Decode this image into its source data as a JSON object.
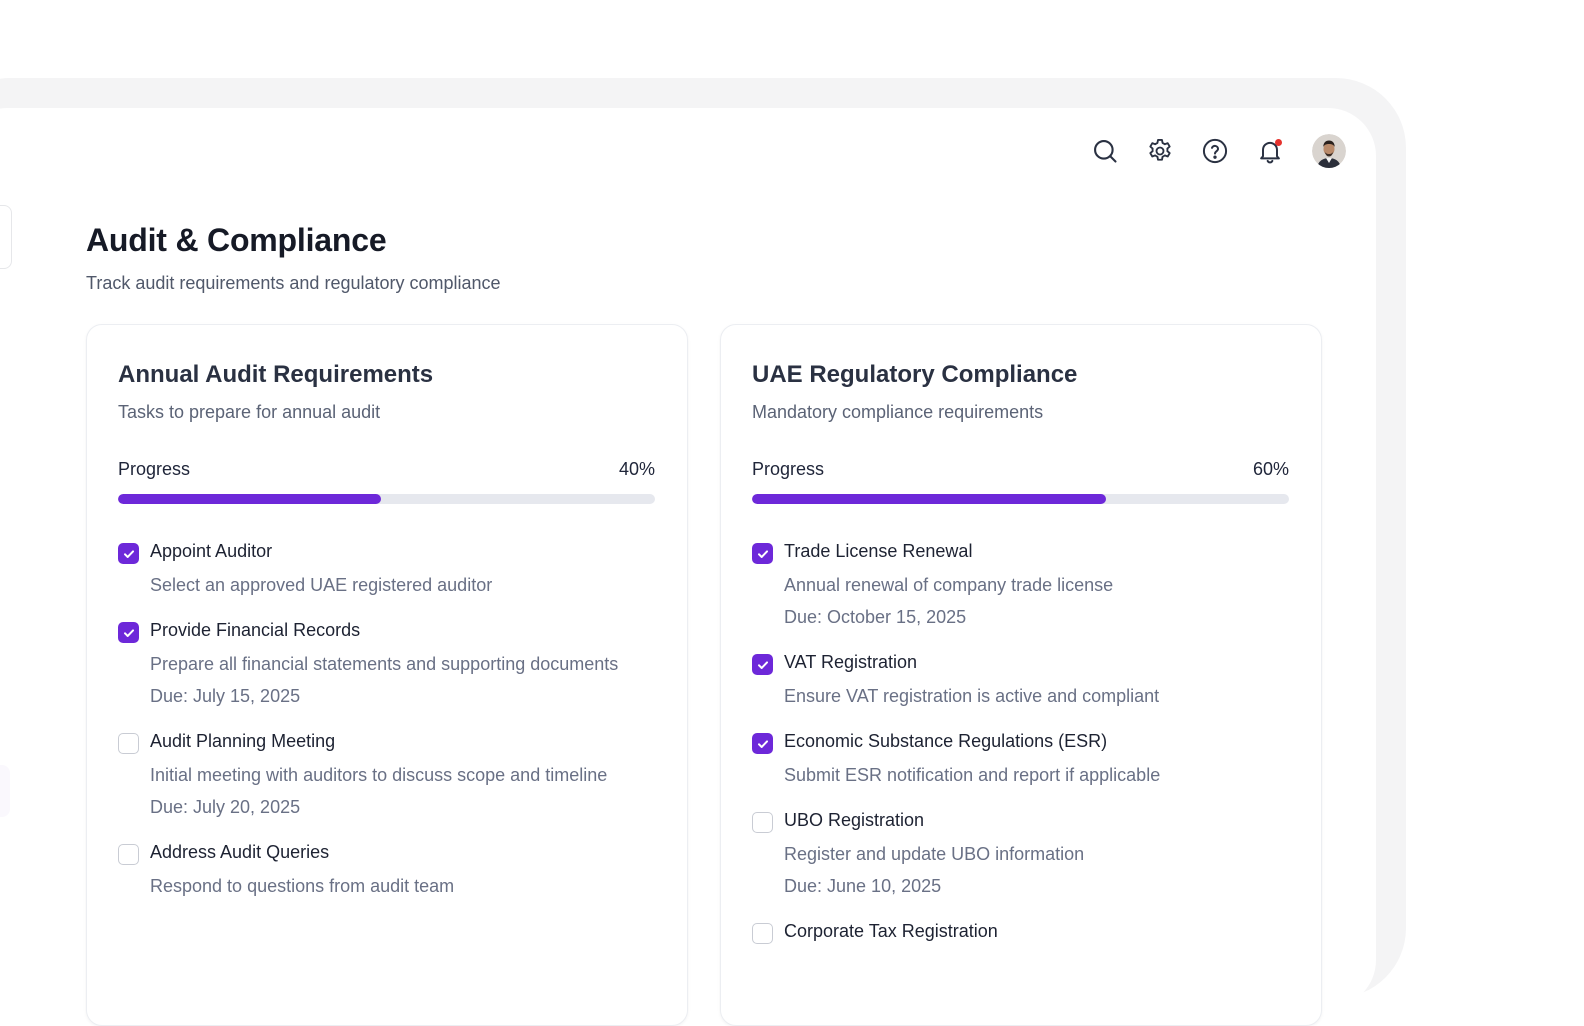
{
  "header": {
    "title": "Audit & Compliance",
    "subtitle": "Track audit requirements and regulatory compliance"
  },
  "topbar": {
    "icons": [
      "search-icon",
      "gear-icon",
      "help-icon",
      "bell-icon",
      "avatar"
    ]
  },
  "colors": {
    "accent": "#6d28d9",
    "track": "#e6e8ee",
    "notification": "#e5322d"
  },
  "cards": [
    {
      "title": "Annual Audit Requirements",
      "description": "Tasks to prepare for annual audit",
      "progress_label": "Progress",
      "progress_text": "40%",
      "progress_fill_percent": 49,
      "tasks": [
        {
          "title": "Appoint Auditor",
          "description": "Select an approved UAE registered auditor",
          "due": "",
          "checked": true
        },
        {
          "title": "Provide Financial Records",
          "description": "Prepare all financial statements and supporting documents",
          "due": "Due: July 15, 2025",
          "checked": true
        },
        {
          "title": "Audit Planning Meeting",
          "description": "Initial meeting with auditors to discuss scope and timeline",
          "due": "Due: July 20, 2025",
          "checked": false
        },
        {
          "title": "Address Audit Queries",
          "description": "Respond to questions from audit team",
          "due": "",
          "checked": false
        }
      ]
    },
    {
      "title": "UAE Regulatory Compliance",
      "description": "Mandatory compliance requirements",
      "progress_label": "Progress",
      "progress_text": "60%",
      "progress_fill_percent": 66,
      "tasks": [
        {
          "title": "Trade License Renewal",
          "description": "Annual renewal of company trade license",
          "due": "Due: October 15, 2025",
          "checked": true
        },
        {
          "title": "VAT Registration",
          "description": "Ensure VAT registration is active and compliant",
          "due": "",
          "checked": true
        },
        {
          "title": "Economic Substance Regulations (ESR)",
          "description": "Submit ESR notification and report if applicable",
          "due": "",
          "checked": true
        },
        {
          "title": "UBO Registration",
          "description": "Register and update UBO information",
          "due": "Due: June 10, 2025",
          "checked": false
        },
        {
          "title": "Corporate Tax Registration",
          "description": "",
          "due": "",
          "checked": false
        }
      ]
    }
  ]
}
